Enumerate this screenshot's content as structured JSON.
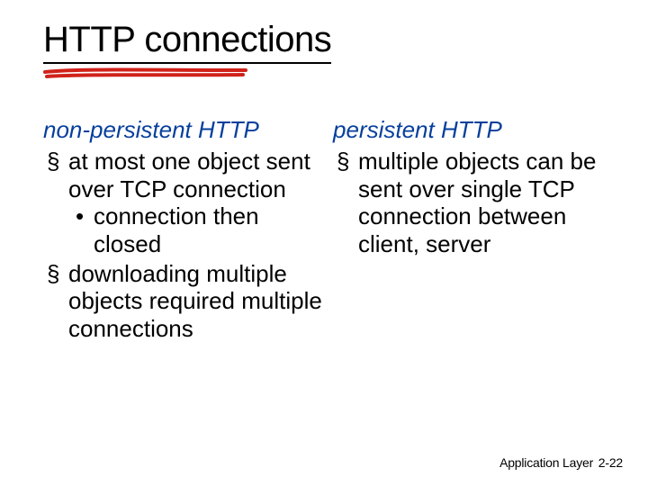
{
  "title": "HTTP connections",
  "left": {
    "heading": "non-persistent HTTP",
    "items": [
      {
        "text": "at most one object sent over TCP connection",
        "sub": [
          "connection then closed"
        ]
      },
      {
        "text": "downloading multiple objects required multiple connections"
      }
    ]
  },
  "right": {
    "heading": "persistent HTTP",
    "items": [
      {
        "text": "multiple objects can be sent over single TCP connection between client, server"
      }
    ]
  },
  "footer": {
    "label": "Application Layer",
    "page": "2-22"
  }
}
